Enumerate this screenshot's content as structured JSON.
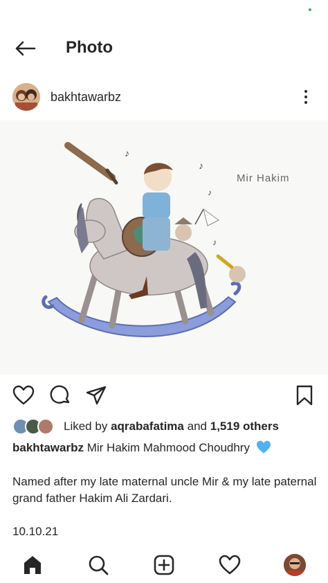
{
  "header": {
    "title": "Photo",
    "back_icon": "arrow-left-icon"
  },
  "post": {
    "username": "bakhtawarbz",
    "image_caption": "Mir  Hakim",
    "likes": {
      "prefix": "Liked by",
      "liker": "aqrabafatima",
      "joiner": "and",
      "others": "1,519 others"
    },
    "caption_user": "bakhtawarbz",
    "caption_title": "Mir Hakim Mahmood Choudhry",
    "caption_body": "Named after my late maternal uncle Mir & my late paternal grand father Hakim Ali Zardari.",
    "date": "10.10.21"
  },
  "colors": {
    "text": "#262626",
    "heart_blue": "#4fb3f0",
    "status_dot": "#3bb54a",
    "horse_rocker": "#7d8fd0"
  },
  "icons": {
    "like": "heart-icon",
    "comment": "comment-icon",
    "share": "send-icon",
    "save": "bookmark-icon",
    "nav": [
      "home-icon",
      "search-icon",
      "add-post-icon",
      "activity-heart-icon",
      "profile-avatar"
    ]
  }
}
